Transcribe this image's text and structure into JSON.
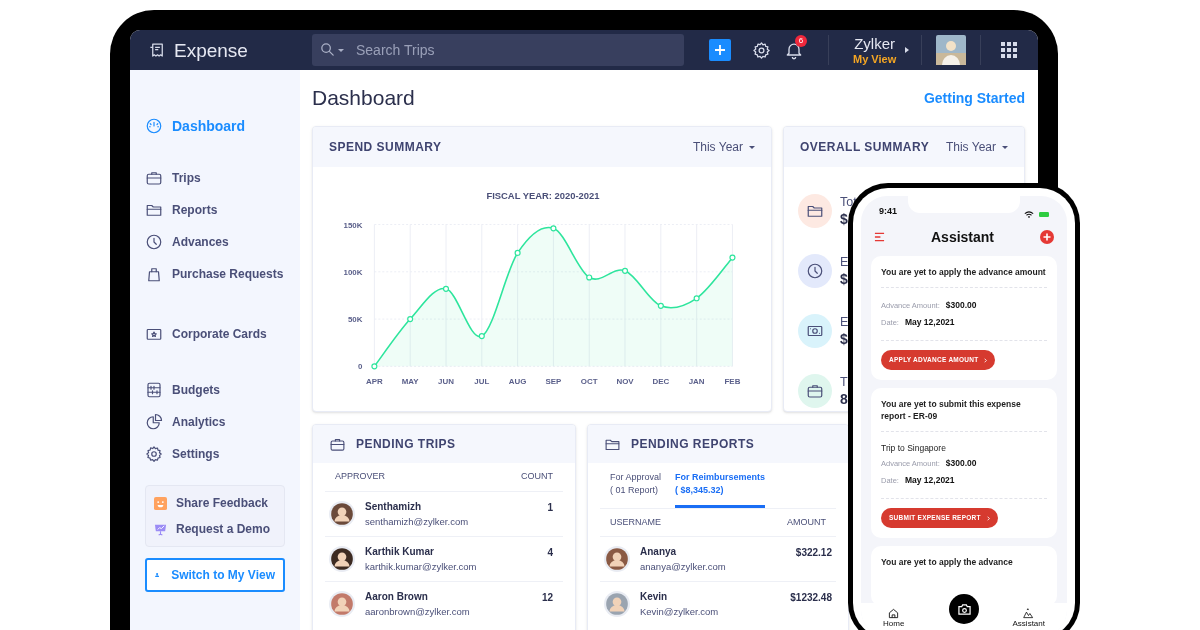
{
  "app": {
    "name": "Expense"
  },
  "search": {
    "placeholder": "Search Trips"
  },
  "notifications": {
    "count": "6"
  },
  "account": {
    "organization": "Zylker",
    "view": "My View"
  },
  "sidebar": {
    "groups": [
      {
        "items": [
          {
            "label": "Dashboard",
            "selected": true
          }
        ]
      },
      {
        "items": [
          {
            "label": "Trips",
            "selected": false
          },
          {
            "label": "Reports",
            "selected": false
          },
          {
            "label": "Advances",
            "selected": false
          },
          {
            "label": "Purchase Requests",
            "selected": false
          }
        ]
      },
      {
        "items": [
          {
            "label": "Corporate Cards",
            "selected": false
          }
        ]
      },
      {
        "items": [
          {
            "label": "Budgets",
            "selected": false
          },
          {
            "label": "Analytics",
            "selected": false
          },
          {
            "label": "Settings",
            "selected": false
          }
        ]
      }
    ],
    "help_links": [
      "Share Feedback",
      "Request a Demo"
    ],
    "switch_button": "Switch to My View"
  },
  "page": {
    "title": "Dashboard",
    "link": "Getting Started"
  },
  "spend_summary": {
    "title": "SPEND SUMMARY",
    "period": "This Year",
    "chart_data": {
      "type": "area",
      "title": "FISCAL YEAR: 2020-2021",
      "categories": [
        "APR",
        "MAY",
        "JUN",
        "JUL",
        "AUG",
        "SEP",
        "OCT",
        "NOV",
        "DEC",
        "JAN",
        "FEB"
      ],
      "grid": true,
      "series": [
        {
          "color": "#2ee59d",
          "values": [
            0,
            50000,
            82000,
            32000,
            120000,
            146000,
            94000,
            101000,
            64000,
            72000,
            115000
          ]
        }
      ],
      "ylim": [
        0,
        150000
      ],
      "yticks": [
        {
          "value": 0,
          "label": "0"
        },
        {
          "value": 50000,
          "label": "50K"
        },
        {
          "value": 100000,
          "label": "100K"
        },
        {
          "value": 150000,
          "label": "150K"
        }
      ]
    }
  },
  "overall_summary": {
    "title": "OVERALL SUMMARY",
    "period": "This Year",
    "items": [
      {
        "label": "Tot",
        "value": "$",
        "color": "#fde9e2"
      },
      {
        "label": "E",
        "value": "$",
        "color": "#e3e9fb"
      },
      {
        "label": "E",
        "value": "$",
        "color": "#d9f3fb"
      },
      {
        "label": "T",
        "value": "8",
        "color": "#dff6ee"
      }
    ]
  },
  "pending_trips": {
    "title": "PENDING TRIPS",
    "columns": [
      "APPROVER",
      "COUNT"
    ],
    "rows": [
      {
        "name": "Senthamizh",
        "email": "senthamizh@zylker.com",
        "count": "1"
      },
      {
        "name": "Karthik Kumar",
        "email": "karthik.kumar@zylker.com",
        "count": "4"
      },
      {
        "name": "Aaron Brown",
        "email": "aaronbrown@zylker.com",
        "count": "12"
      }
    ]
  },
  "pending_reports": {
    "title": "PENDING REPORTS",
    "tabs": [
      {
        "label": "For Approval",
        "detail": "( 01 Report)",
        "selected": false
      },
      {
        "label": "For Reimbursements",
        "detail": "( $8,345.32)",
        "selected": true
      }
    ],
    "columns": [
      "USERNAME",
      "AMOUNT"
    ],
    "rows": [
      {
        "name": "Ananya",
        "email": "ananya@zylker.com",
        "amount": "$322.12"
      },
      {
        "name": "Kevin",
        "email": "Kevin@zylker.com",
        "amount": "$1232.48"
      }
    ]
  },
  "phone": {
    "time": "9:41",
    "title": "Assistant",
    "cards": [
      {
        "message": "You are yet to apply the advance amount",
        "fields": [
          {
            "label": "Advance Amount:",
            "value": "$300.00"
          },
          {
            "label": "Date:",
            "value": "May 12,2021"
          }
        ],
        "action": "APPLY ADVANCE AMOUNT"
      },
      {
        "message": "You are yet to submit this expense report - ER-09",
        "trip": "Trip to Singapore",
        "fields": [
          {
            "label": "Advance Amount:",
            "value": "$300.00"
          },
          {
            "label": "Date:",
            "value": "May 12,2021"
          }
        ],
        "action": "SUBMIT EXPENSE REPORT"
      },
      {
        "message": "You are yet to apply the advance"
      }
    ],
    "tabs": [
      {
        "label": "Home"
      },
      {
        "label": "Assistant"
      }
    ]
  }
}
